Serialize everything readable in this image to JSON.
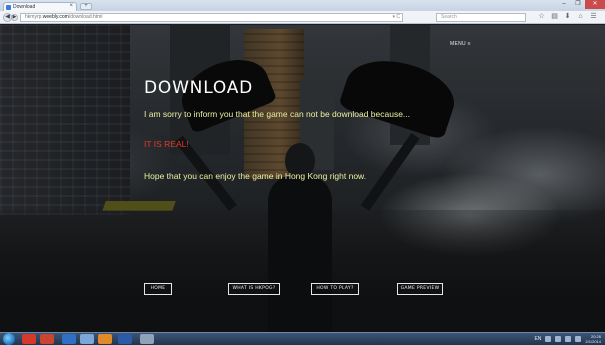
{
  "browser": {
    "tab_title": "Download",
    "url_prefix": "hkmyrp.",
    "url_domain": "weebly.com",
    "url_path": "/download.html",
    "url_tools": "▾ C",
    "search_placeholder": "Search",
    "new_tab": "+",
    "tab_close": "×",
    "back": "◀",
    "forward": "▶",
    "window_controls": {
      "minimize": "–",
      "maximize": "❐",
      "close": "✕"
    },
    "toolbar_icons": [
      "☆",
      "▤",
      "⬇",
      "⌂",
      "☰"
    ]
  },
  "page": {
    "menu_label": "MENU ≡",
    "title": "DOWNLOAD",
    "message_1": "I am sorry to inform you that the game can not be download because...",
    "message_2": "IT IS REAL!",
    "message_3": "Hope that  you can enjoy the game in Hong Kong right now.",
    "buttons": {
      "home": "HOME",
      "what_is": "WHAT IS HKPOG?",
      "how_to_play": "HOW TO PLAY?",
      "game_preview": "GAME PREVIEW"
    }
  },
  "taskbar": {
    "lang": "EN",
    "time": "20:26",
    "date": "2/1/2014"
  },
  "colors": {
    "accent_yellow": "#eaf0a0",
    "alert_red": "#e53a2a"
  }
}
